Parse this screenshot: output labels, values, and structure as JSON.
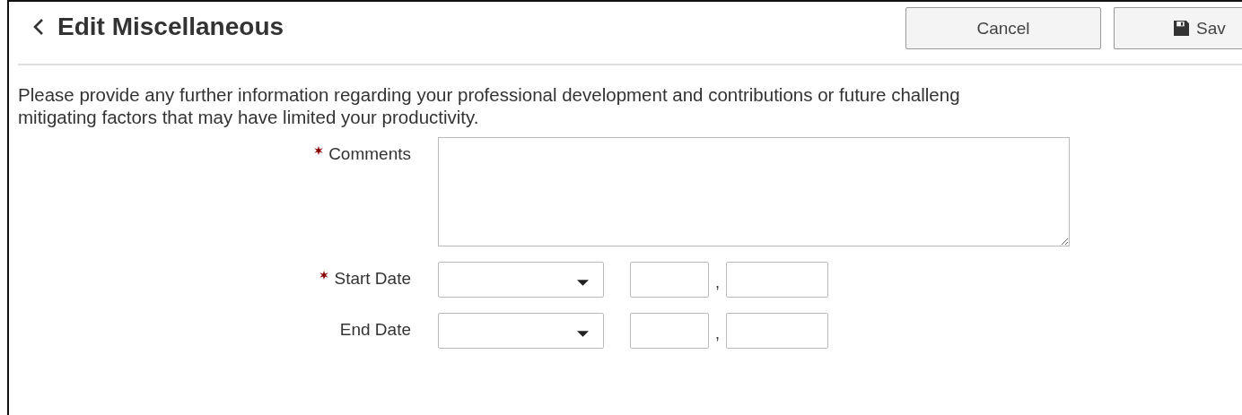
{
  "header": {
    "title": "Edit Miscellaneous",
    "buttons": [
      {
        "kind": "cancel",
        "label": "Cancel"
      },
      {
        "kind": "save",
        "label": "Sav"
      }
    ]
  },
  "description": [
    "Please provide any further information regarding your professional development and contributions or future challeng",
    "mitigating factors that may have limited your productivity."
  ],
  "fields": [
    {
      "kind": "textarea",
      "label": "Comments",
      "required": true
    },
    {
      "kind": "date",
      "label": "Start Date",
      "required": true,
      "separator": ","
    },
    {
      "kind": "date",
      "label": "End Date",
      "required": false,
      "separator": ","
    }
  ]
}
